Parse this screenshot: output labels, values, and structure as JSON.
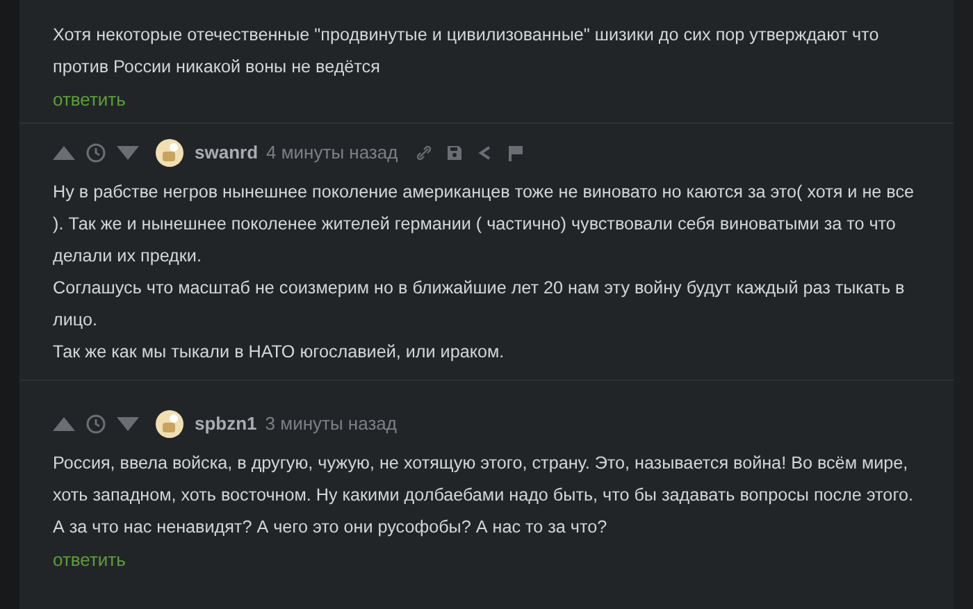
{
  "comments": [
    {
      "paragraphs": [
        "Хотя некоторые отечественные \"продвинутые и цивилизованные\" шизики до сих пор утверждают что против России никакой воны не ведётся"
      ],
      "reply": "ответить"
    },
    {
      "author": "swanrd",
      "time": "4 минуты назад",
      "tools": true,
      "paragraphs": [
        "Ну в рабстве негров нынешнее поколение американцев тоже не виновато но каются за это( хотя и не все ). Так же и нынешнее поколенее жителей германии ( частично) чувствовали себя виноватыми за то что делали их предки.",
        "Соглашусь что масштаб не соизмерим но в ближайшие лет 20 нам эту войну будут каждый раз тыкать в лицо.",
        "Так же как мы тыкали в НАТО югославией, или ираком."
      ]
    },
    {
      "author": "spbzn1",
      "time": "3 минуты назад",
      "tools": false,
      "paragraphs": [
        "Россия, ввела войска, в другую, чужую, не хотящую этого, страну. Это, называется война! Во всём мире, хоть западном, хоть восточном. Ну какими долбаебами надо быть, что бы задавать вопросы после этого.  А за что нас ненавидят? А чего это они русофобы? А нас то за что?"
      ],
      "reply": "ответить"
    }
  ]
}
